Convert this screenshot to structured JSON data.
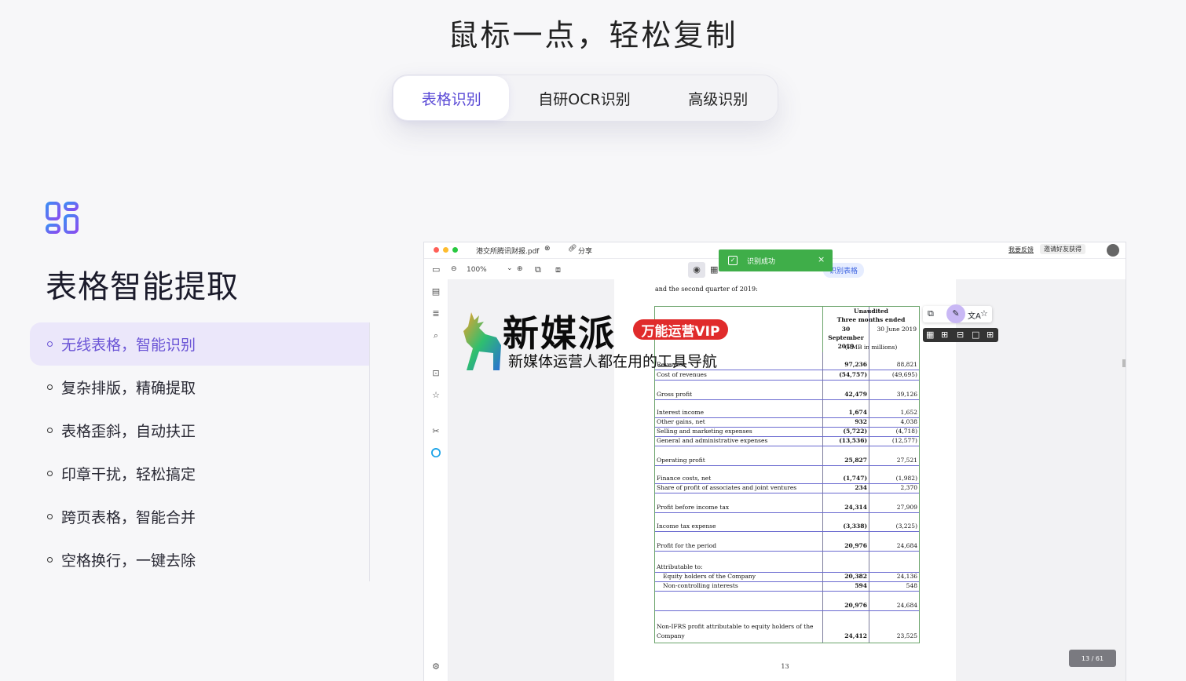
{
  "hero": {
    "title": "鼠标一点，轻松复制"
  },
  "tabs": [
    {
      "label": "表格识别"
    },
    {
      "label": "自研OCR识别"
    },
    {
      "label": "高级识别"
    }
  ],
  "feature": {
    "title": "表格智能提取",
    "items": [
      "无线表格，智能识别",
      "复杂排版，精确提取",
      "表格歪斜，自动扶正",
      "印章干扰，轻松搞定",
      "跨页表格，智能合并",
      "空格换行，一键去除"
    ]
  },
  "app": {
    "filename": "港交所腾讯财报.pdf",
    "share": "分享",
    "feedback": "我要反馈",
    "invite": "邀请好友获得",
    "zoom": "100%",
    "recognize_table": "识别表格",
    "toast": "识别成功",
    "page_indicator": "13 / 61",
    "page_number": "13",
    "intro_text": "and the second quarter of 2019:",
    "table": {
      "header_a": "Unaudited",
      "header_b": "Three months ended",
      "col1_header": "30 September 2019",
      "col2_header": "30 June 2019",
      "unit": "(RMB in millions)",
      "rows": [
        {
          "label": "Revenues",
          "v1": "97,236",
          "v2": "88,821"
        },
        {
          "label": "Cost of revenues",
          "v1": "(54,757)",
          "v2": "(49,695)"
        },
        {
          "label": "Gross profit",
          "v1": "42,479",
          "v2": "39,126"
        },
        {
          "label": "Interest income",
          "v1": "1,674",
          "v2": "1,652"
        },
        {
          "label": "Other gains, net",
          "v1": "932",
          "v2": "4,038"
        },
        {
          "label": "Selling and marketing expenses",
          "v1": "(5,722)",
          "v2": "(4,718)"
        },
        {
          "label": "General and administrative expenses",
          "v1": "(13,536)",
          "v2": "(12,577)"
        },
        {
          "label": "Operating profit",
          "v1": "25,827",
          "v2": "27,521"
        },
        {
          "label": "Finance costs, net",
          "v1": "(1,747)",
          "v2": "(1,982)"
        },
        {
          "label": "Share of profit of associates and joint ventures",
          "v1": "234",
          "v2": "2,370"
        },
        {
          "label": "Profit before income tax",
          "v1": "24,314",
          "v2": "27,909"
        },
        {
          "label": "Income tax expense",
          "v1": "(3,338)",
          "v2": "(3,225)"
        },
        {
          "label": "Profit for the period",
          "v1": "20,976",
          "v2": "24,684"
        },
        {
          "label": "Attributable to:",
          "v1": "",
          "v2": ""
        },
        {
          "label": "Equity holders of the Company",
          "v1": "20,382",
          "v2": "24,136"
        },
        {
          "label": "Non-controlling interests",
          "v1": "594",
          "v2": "548"
        },
        {
          "label": "",
          "v1": "20,976",
          "v2": "24,684"
        },
        {
          "label": "Non-IFRS profit attributable to equity holders of the Company",
          "v1": "24,412",
          "v2": "23,525"
        }
      ]
    }
  },
  "watermark": {
    "title": "新媒派",
    "badge": "万能运营VIP",
    "subtitle": "新媒体运营人都在用的工具导航"
  },
  "colors": {
    "accent": "#6b55d6",
    "active_bg": "#ebe7fa",
    "toast": "#3fae49"
  }
}
